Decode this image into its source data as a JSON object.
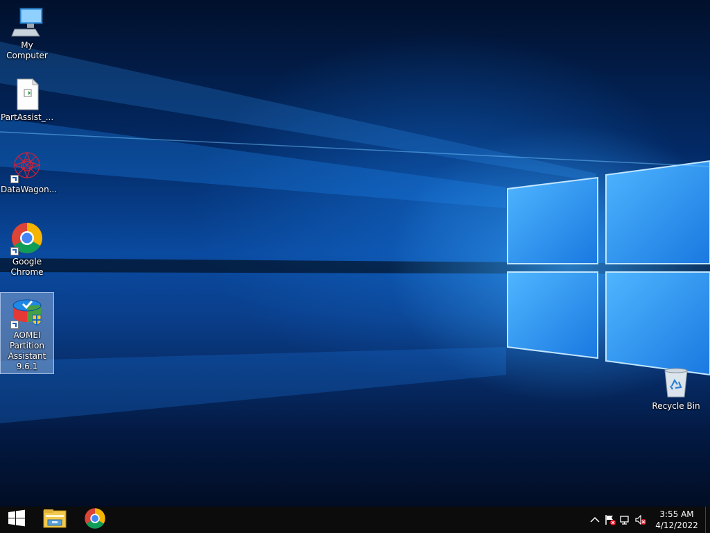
{
  "desktop": {
    "icons": [
      {
        "label": "My Computer",
        "icon": "computer-icon"
      },
      {
        "label": "PartAssist_...",
        "icon": "installer-file-icon"
      },
      {
        "label": "DataWagon...",
        "icon": "datawagon-icon"
      },
      {
        "label": "Google Chrome",
        "icon": "chrome-icon"
      },
      {
        "label": "AOMEI Partition Assistant 9.6.1",
        "icon": "aomei-icon",
        "selected": true
      },
      {
        "label": "Recycle Bin",
        "icon": "recycle-bin-icon"
      }
    ]
  },
  "taskbar": {
    "pinned": [
      "start-windows-icon",
      "file-explorer-icon",
      "chrome-icon"
    ],
    "tray": [
      "show-hidden-icons-chevron",
      "action-center-flag-icon",
      "network-icon",
      "volume-muted-icon"
    ],
    "clock": {
      "time": "3:55 AM",
      "date": "4/12/2022"
    }
  },
  "colors": {
    "taskbar": "#0c0c0c",
    "wallpaper_accent": "#1f8fff",
    "selection": "#a0bee6"
  }
}
